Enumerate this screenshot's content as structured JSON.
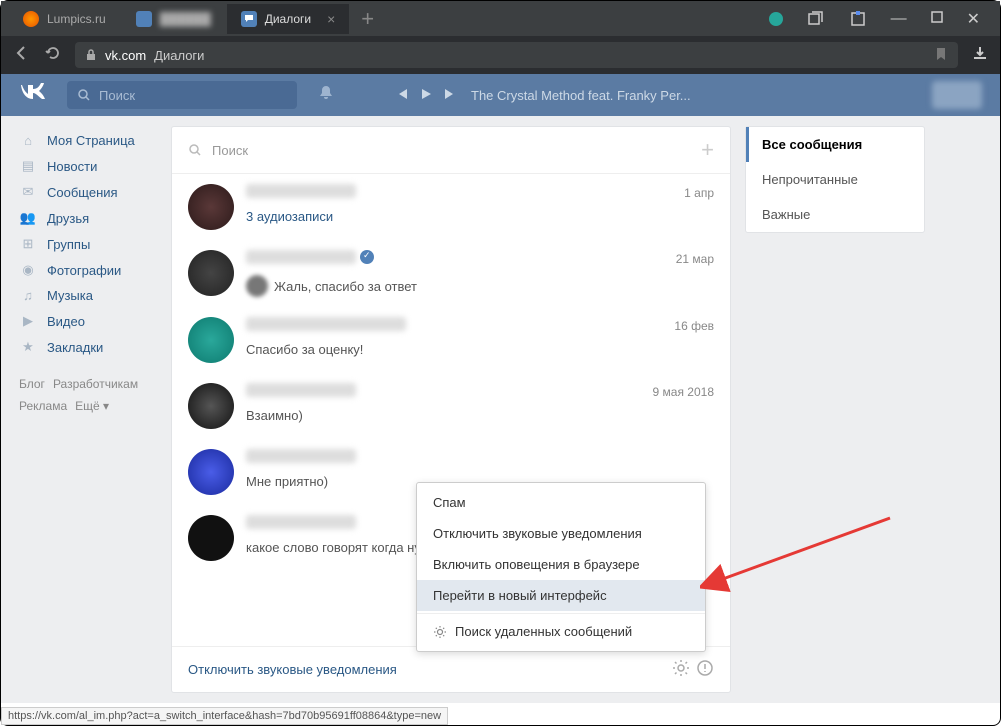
{
  "browser": {
    "tabs": [
      {
        "label": "Lumpics.ru",
        "favicon": "orange"
      },
      {
        "label": "██████",
        "favicon": "vk"
      },
      {
        "label": "Диалоги",
        "favicon": "vk",
        "active": true
      }
    ],
    "url_domain": "vk.com",
    "url_path": "Диалоги"
  },
  "vk_header": {
    "search_placeholder": "Поиск",
    "now_playing": "The Crystal Method feat. Franky Per..."
  },
  "nav": {
    "items": [
      {
        "icon": "home",
        "label": "Моя Страница"
      },
      {
        "icon": "news",
        "label": "Новости"
      },
      {
        "icon": "msg",
        "label": "Сообщения"
      },
      {
        "icon": "friends",
        "label": "Друзья"
      },
      {
        "icon": "groups",
        "label": "Группы"
      },
      {
        "icon": "photo",
        "label": "Фотографии"
      },
      {
        "icon": "music",
        "label": "Музыка"
      },
      {
        "icon": "video",
        "label": "Видео"
      },
      {
        "icon": "bookmark",
        "label": "Закладки"
      }
    ],
    "footer": {
      "blog": "Блог",
      "devs": "Разработчикам",
      "ads": "Реклама",
      "more": "Ещё"
    }
  },
  "dialogs": {
    "search_placeholder": "Поиск",
    "items": [
      {
        "msg": "3 аудиозаписи",
        "date": "1 апр",
        "link": true,
        "reply": false,
        "verified": false,
        "avatar": "av1"
      },
      {
        "msg": "Жаль, спасибо за ответ",
        "date": "21 мар",
        "link": false,
        "reply": true,
        "verified": true,
        "avatar": "av2"
      },
      {
        "msg": "Спасибо за оценку!",
        "date": "16 фев",
        "link": false,
        "reply": false,
        "verified": false,
        "avatar": "av3"
      },
      {
        "msg": "Взаимно)",
        "date": "9 мая 2018",
        "link": false,
        "reply": false,
        "verified": false,
        "avatar": "av4"
      },
      {
        "msg": "Мне приятно)",
        "date": "",
        "link": false,
        "reply": false,
        "verified": false,
        "avatar": "av5"
      },
      {
        "msg": "какое слово говорят когда нуж",
        "date": "",
        "link": false,
        "reply": false,
        "verified": false,
        "avatar": "av6"
      }
    ],
    "footer_link": "Отключить звуковые уведомления"
  },
  "context_menu": {
    "items": [
      {
        "label": "Спам"
      },
      {
        "label": "Отключить звуковые уведомления"
      },
      {
        "label": "Включить оповещения в браузере"
      },
      {
        "label": "Перейти в новый интерфейс",
        "hover": true
      },
      {
        "label": "Поиск удаленных сообщений",
        "icon": "gear"
      }
    ]
  },
  "filters": {
    "items": [
      {
        "label": "Все сообщения",
        "active": true
      },
      {
        "label": "Непрочитанные"
      },
      {
        "label": "Важные"
      }
    ]
  },
  "status_bar": "https://vk.com/al_im.php?act=a_switch_interface&hash=7bd70b95691ff08864&type=new"
}
